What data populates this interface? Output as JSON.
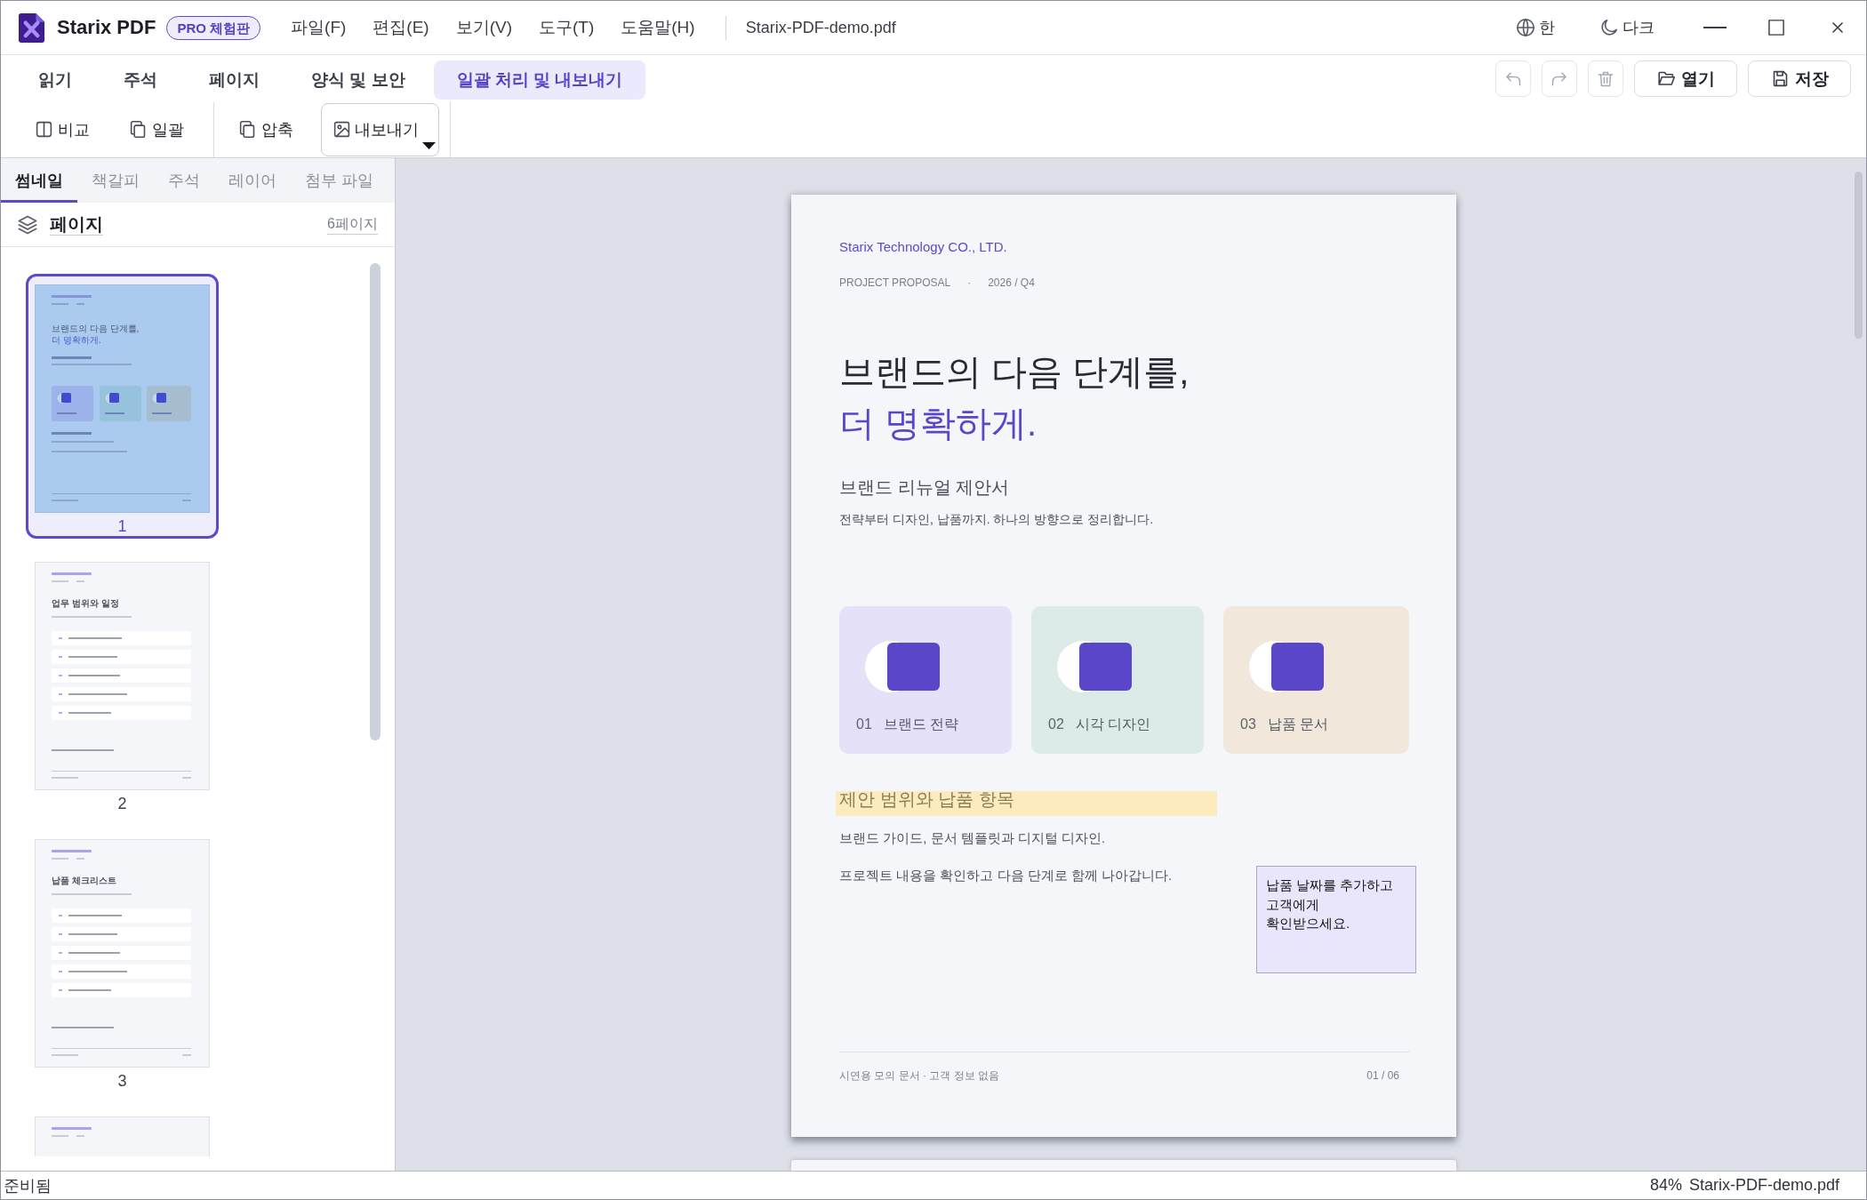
{
  "app": {
    "name": "Starix PDF",
    "badge": "PRO 체험판"
  },
  "menu": [
    "파일(F)",
    "편집(E)",
    "보기(V)",
    "도구(T)",
    "도움말(H)"
  ],
  "window": {
    "title": "Starix-PDF-demo.pdf"
  },
  "title_controls": [
    {
      "kind": "language",
      "label": "한"
    },
    {
      "kind": "theme",
      "label": "다크"
    }
  ],
  "window_controls": [
    {
      "kind": "minimize"
    },
    {
      "kind": "maximize"
    },
    {
      "kind": "close"
    }
  ],
  "ribbon_tabs": [
    {
      "label": "읽기",
      "selected": false
    },
    {
      "label": "주석",
      "selected": false
    },
    {
      "label": "페이지",
      "selected": false
    },
    {
      "label": "양식 및 보안",
      "selected": false
    },
    {
      "label": "일괄 처리 및 내보내기",
      "selected": true
    }
  ],
  "history_buttons": [
    {
      "kind": "undo",
      "disabled": true
    },
    {
      "kind": "redo",
      "disabled": true
    },
    {
      "kind": "delete",
      "disabled": true
    }
  ],
  "file_buttons": [
    {
      "kind": "open",
      "label": "열기"
    },
    {
      "kind": "save",
      "label": "저장"
    }
  ],
  "toolbar": [
    {
      "items": [
        {
          "kind": "compare",
          "label": "비교",
          "selected": false,
          "dropdown": false
        },
        {
          "kind": "batch",
          "label": "일괄",
          "selected": false,
          "dropdown": false
        }
      ]
    },
    {
      "items": [
        {
          "kind": "compress",
          "label": "압축",
          "selected": false,
          "dropdown": false
        },
        {
          "kind": "export",
          "label": "내보내기",
          "selected": true,
          "dropdown": true
        }
      ]
    }
  ],
  "sidebar": {
    "tabs": [
      {
        "label": "썸네일",
        "selected": true
      },
      {
        "label": "책갈피",
        "selected": false
      },
      {
        "label": "주석",
        "selected": false
      },
      {
        "label": "레이어",
        "selected": false
      },
      {
        "label": "첨부 파일",
        "selected": false
      }
    ],
    "header": {
      "title": "페이지",
      "count": "6페이지"
    },
    "thumbnails": [
      {
        "kind": "cover",
        "label": "1",
        "selected": true,
        "heading": [
          "브랜드의 다음 단계를,",
          "더 명확하게."
        ]
      },
      {
        "kind": "list",
        "label": "2",
        "selected": false,
        "heading": [
          "업무 범위와 일정"
        ]
      },
      {
        "kind": "list",
        "label": "3",
        "selected": false,
        "heading": [
          "납품 체크리스트"
        ]
      },
      {
        "selected": false
      }
    ]
  },
  "document": {
    "company": "Starix Technology CO., LTD.",
    "meta": [
      "PROJECT PROPOSAL",
      "·",
      "2026 / Q4"
    ],
    "headline": [
      "브랜드의 다음 단계를,",
      "더 명확하게."
    ],
    "subtitle": "브랜드 리뉴얼 제안서",
    "intro": "전략부터 디자인, 납품까지. 하나의 방향으로 정리합니다.",
    "cards": [
      {
        "number": "01",
        "title": "브랜드 전략",
        "color": "#e5e1f8"
      },
      {
        "number": "02",
        "title": "시각 디자인",
        "color": "#dcebe7"
      },
      {
        "number": "03",
        "title": "납품 문서",
        "color": "#f1e7da"
      }
    ],
    "section": {
      "title": "제안 범위와 납품 항목",
      "highlighted": true
    },
    "paragraphs": [
      "브랜드 가이드, 문서 템플릿과 디지털 디자인.",
      "프로젝트 내용을 확인하고 다음 단계로 함께 나아갑니다."
    ],
    "note": "납품 날짜를 추가하고\n고객에게\n확인받으세요.",
    "footer": {
      "left": "시연용 모의 문서 · 고객 정보 없음",
      "right": "01 / 06"
    }
  },
  "status_bar": {
    "message": "준비됨",
    "zoom": "84%",
    "file": "Starix-PDF-demo.pdf"
  }
}
